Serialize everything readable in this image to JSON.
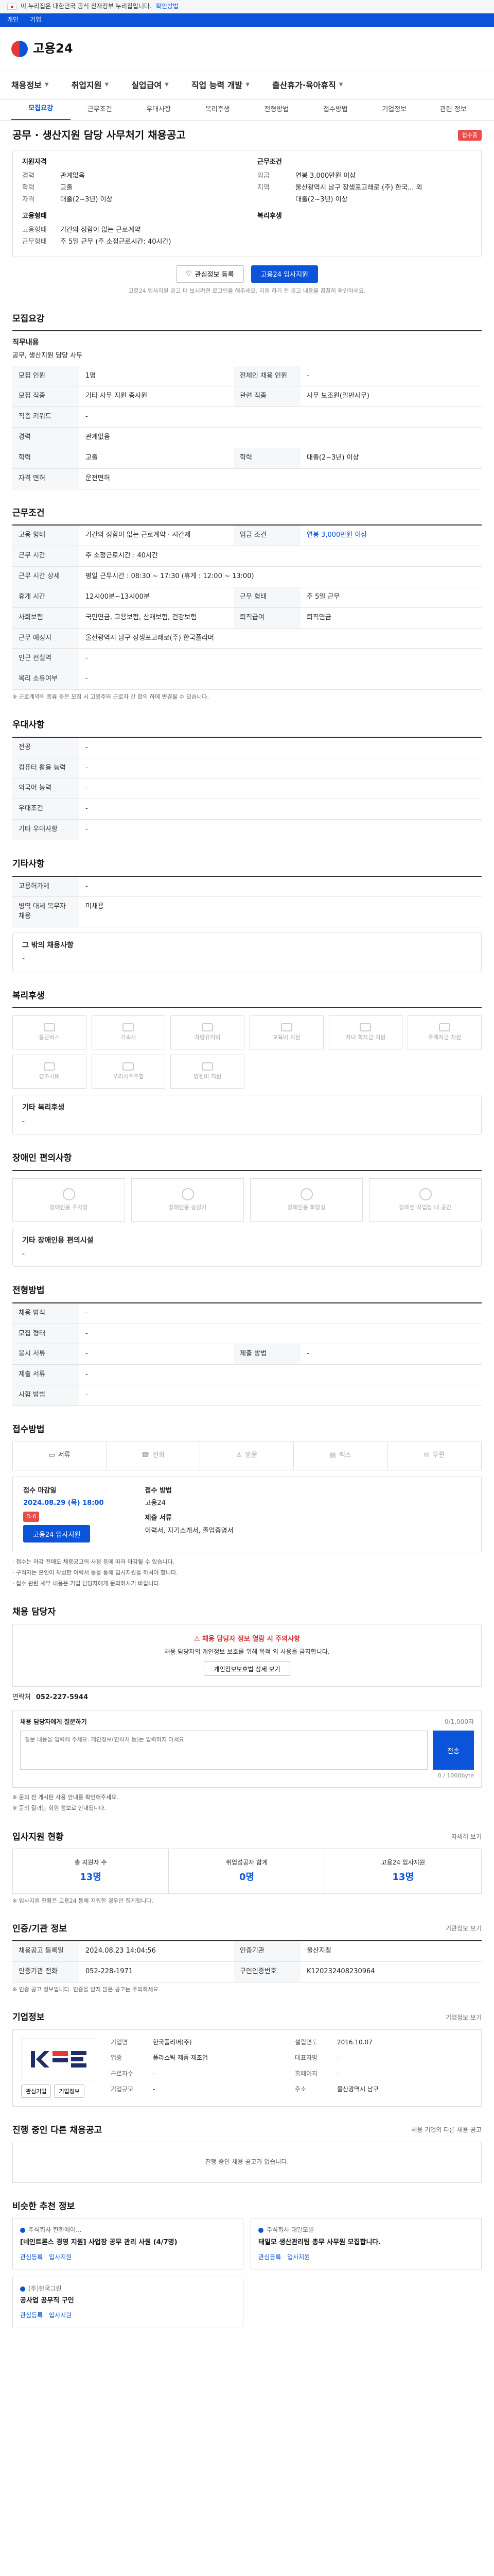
{
  "banner": {
    "text": "이 누리집은 대한민국 공식 전자정부 누리집입니다.",
    "link": "확인방법"
  },
  "topbar": {
    "items": [
      "개인",
      "기업"
    ]
  },
  "logo": {
    "text": "고용24"
  },
  "gnb": {
    "items": [
      "채용정보",
      "취업지원",
      "실업급여",
      "직업 능력 개발",
      "출산휴가·육아휴직"
    ]
  },
  "tabs": [
    "모집요강",
    "근무조건",
    "우대사항",
    "복리후생",
    "전형방법",
    "접수방법",
    "기업정보",
    "관련 정보"
  ],
  "job": {
    "title": "공무 · 생산지원 담당 사무처기 채용공고",
    "status": "접수중"
  },
  "summary": {
    "left_title": "지원자격",
    "left": [
      {
        "k": "경력",
        "v": "관계없음"
      },
      {
        "k": "학력",
        "v": "고졸"
      },
      {
        "k": "자격",
        "v": "대졸(2~3년) 이상"
      }
    ],
    "left2_title": "고용형태",
    "left2": [
      {
        "k": "고용형태",
        "v": "기간의 정함이 없는 근로계약"
      },
      {
        "k": "근무형태",
        "v": "주 5일 근무 (주 소정근로시간: 40시간)"
      }
    ],
    "right_title": "근무조건",
    "right": [
      {
        "k": "임금",
        "v": "연봉 3,000만원 이상"
      },
      {
        "k": "지역",
        "v": "울산광역시 남구 장생포고래로 (주) 한국... 외"
      },
      {
        "k": "",
        "v": "대졸(2~3년) 이상"
      }
    ],
    "right2_title": "복리후생",
    "right2": []
  },
  "actions": {
    "scrap": "관심정보 등록",
    "apply": "고용24 입사지원",
    "note": "고용24 입사지원 공고 더 보시려면 로그인을 해주세요. 지원 하기 전 공고 내용을 꼼꼼히 확인하세요."
  },
  "recruit": {
    "title": "모집요강",
    "duty_label": "직무내용",
    "duty": "공무, 생산지원 담당 사무",
    "rows": [
      {
        "k1": "모집 인원",
        "v1": "1명",
        "k2": "전체인 채용 인원",
        "v2": "-"
      },
      {
        "k1": "모집 직종",
        "v1": "기타 사무 지원 종사원",
        "k2": "관련 직종",
        "v2": "사무 보조원(일반사무)"
      },
      {
        "k1": "직종 키워드",
        "v1": "-",
        "k2": "",
        "v2": ""
      },
      {
        "k1": "경력",
        "v1": "관계없음",
        "k2": "",
        "v2": ""
      },
      {
        "k1": "학력",
        "v1": "고졸",
        "k2": "학력",
        "v2": "대졸(2~3년) 이상"
      },
      {
        "k1": "자격 면허",
        "v1": "운전면허",
        "k2": "",
        "v2": ""
      }
    ]
  },
  "work": {
    "title": "근무조건",
    "rows": [
      {
        "k": "고용 형태",
        "v": "기간의 정함이 없는 근로계약 · 시간제",
        "k2": "임금 조건",
        "v2": "연봉 3,000만원 이상"
      },
      {
        "k": "근무 시간",
        "v": "주 소정근로시간 : 40시간",
        "k2": "",
        "v2": ""
      },
      {
        "k": "근무 시간 상세",
        "v": "평일 근무시간 : 08:30 ~ 17:30 (휴게 : 12:00 ~ 13:00)",
        "k2": "",
        "v2": ""
      },
      {
        "k": "휴게 시간",
        "v": "12시00분~13시00분",
        "k2": "근무 형태",
        "v2": "주 5일 근무"
      },
      {
        "k": "사회보험",
        "v": "국민연금, 고용보험, 산재보험, 건강보험",
        "k2": "퇴직급여",
        "v2": "퇴직연금"
      },
      {
        "k": "근무 예정지",
        "v": "울산광역시 남구 장생포고래로(주) 한국폴리머",
        "k2": "",
        "v2": ""
      },
      {
        "k": "인근 전철역",
        "v": "-",
        "k2": "",
        "v2": ""
      },
      {
        "k": "복리 소유여부",
        "v": "-",
        "k2": "",
        "v2": ""
      }
    ],
    "note": "※ 근로계약의 종류 등은 모집 시 고용주와 근로자 간 합의 하에 변경될 수 있습니다."
  },
  "pref": {
    "title": "우대사항",
    "rows": [
      {
        "k": "전공",
        "v": "-"
      },
      {
        "k": "컴퓨터 활용 능력",
        "v": "-"
      },
      {
        "k": "외국어 능력",
        "v": "-"
      },
      {
        "k": "우대조건",
        "v": "-"
      },
      {
        "k": "기타 우대사항",
        "v": "-"
      }
    ]
  },
  "etc": {
    "title": "기타사항",
    "rows": [
      {
        "k": "고용허가제",
        "v": "-"
      },
      {
        "k": "병역 대체 복무자 채용",
        "v": "미채용"
      }
    ],
    "extra_label": "그 밖의 채용사항",
    "extra": "-"
  },
  "welfare": {
    "title": "복리후생",
    "items": [
      "통근버스",
      "기숙사",
      "차량유지비",
      "교육비 지원",
      "자녀 학자금 지원",
      "주택자금 지원",
      "경조사비",
      "우리사주조합",
      "병원비 지원",
      "",
      "",
      ""
    ],
    "etc_label": "기타 복리후생",
    "etc": "-"
  },
  "disability": {
    "title": "장애인 편의사항",
    "items": [
      "장애인용 주차장",
      "장애인용 승강기",
      "장애인용 화장실",
      "장애인 작업장 내 공간"
    ],
    "etc_label": "기타 장애인용 편의시설",
    "etc": "-"
  },
  "selection": {
    "title": "전형방법",
    "rows": [
      {
        "k": "채용 방식",
        "v": "-",
        "k2": "",
        "v2": ""
      },
      {
        "k": "모집 형태",
        "v": "-",
        "k2": "",
        "v2": ""
      },
      {
        "k": "응시 서류",
        "v": "-",
        "k2": "제출 방법",
        "v2": "-"
      },
      {
        "k": "제출 서류",
        "v": "-",
        "k2": "",
        "v2": ""
      },
      {
        "k": "시험 방법",
        "v": "-",
        "k2": "",
        "v2": ""
      }
    ]
  },
  "apply": {
    "title": "접수방법",
    "methods": [
      "서류",
      "전화",
      "방문",
      "팩스",
      "우편"
    ],
    "period_label": "접수 마감일",
    "deadline": "2024.08.29 (목) 18:00",
    "deadline_tag": "D-6",
    "apply_btn": "고용24 입사지원",
    "method_label": "접수 방법",
    "method": "고용24",
    "docs_label": "제출 서류",
    "docs": "이력서, 자기소개서, 졸업증명서",
    "notes": [
      "· 접수는 마감 전에도 채용공고의 사정 등에 따라 마감될 수 있습니다.",
      "· 구직자는 본인이 작성한 이력서 등을 통해 입사지원을 하셔야 합니다.",
      "· 접수 관련 세부 내용은 기업 담당자에게 문의하시기 바랍니다."
    ]
  },
  "recruiter": {
    "title": "채용 담당자",
    "warn": "채용 담당자 정보 열람 시 주의사항",
    "desc": "채용 담당자의 개인정보 보호를 위해 목적 외 사용을 금지합니다.",
    "btn": "개인정보보호법 상세 보기",
    "tel_label": "연락처",
    "tel": "052-227-5944",
    "inq_label": "채용 담당자에게 질문하기",
    "inq_right": "0/1,000자",
    "inq_placeholder": "질문 내용을 입력해 주세요. 개인정보(연락처 등)는 입력하지 마세요.",
    "send": "전송",
    "count": "0 / 1000byte",
    "notes": [
      "※ 문의 전 게시판 사용 안내를 확인해주세요.",
      "※ 문의 결과는 회원 정보로 안내됩니다."
    ]
  },
  "stats": {
    "title": "입사지원 현황",
    "right": "자세히 보기",
    "items": [
      {
        "label": "총 지원자 수",
        "num": "13명"
      },
      {
        "label": "취업성공자 합계",
        "num": "0명"
      },
      {
        "label": "고용24 입사지원",
        "num": "13명"
      }
    ],
    "note": "※ 입사지원 현황은 고용24 통해 지원한 경우만 집계됩니다."
  },
  "cert": {
    "title": "인증/기관 정보",
    "right": "기관정보 보기",
    "rows": [
      {
        "k": "채용공고 등록일",
        "v": "2024.08.23 14:04:56",
        "k2": "인증기관",
        "v2": "울산지청"
      },
      {
        "k": "인증기관 전화",
        "v": "052-228-1971",
        "k2": "구인인증번호",
        "v2": "K120232408230964"
      }
    ],
    "note": "※ 인증 공고 정보입니다. 인증을 받지 않은 공고는 주의하세요."
  },
  "company": {
    "title": "기업정보",
    "right": "기업정보 보기",
    "logo_text": "KRE",
    "info": [
      {
        "k": "기업명",
        "v": "한국폴리머(주)"
      },
      {
        "k": "설립연도",
        "v": "2016.10.07"
      },
      {
        "k": "업종",
        "v": "플라스틱 제품 제조업"
      },
      {
        "k": "대표자명",
        "v": "-"
      },
      {
        "k": "근로자수",
        "v": "-"
      },
      {
        "k": "홈페이지",
        "v": "-"
      },
      {
        "k": "기업규모",
        "v": "-"
      },
      {
        "k": "주소",
        "v": "울산광역시 남구"
      }
    ],
    "btns": [
      "관심기업",
      "기업정보"
    ]
  },
  "related": {
    "title": "진행 중인 다른 채용공고",
    "right": "채용 기업의 다른 채용 공고",
    "empty": "진행 중인 채용 공고가 없습니다."
  },
  "hot": {
    "title": "비슷한 추천 정보",
    "items": [
      {
        "src": "주식회사 한화에어...",
        "ttl": "[네인트론스 경영 지원] 사업장 공무 관리 사원 (4/7명)",
        "tags": [
          "관심등록",
          "입사지원"
        ]
      },
      {
        "src": "주식회사 태일모빌",
        "ttl": "태일모 생산관리팀 총무 사무원 모집합니다.",
        "tags": [
          "관심등록",
          "입사지원"
        ]
      },
      {
        "src": "(주)한국그린",
        "ttl": "공사업 공무직 구인",
        "tags": [
          "관심등록",
          "입사지원"
        ]
      }
    ]
  }
}
